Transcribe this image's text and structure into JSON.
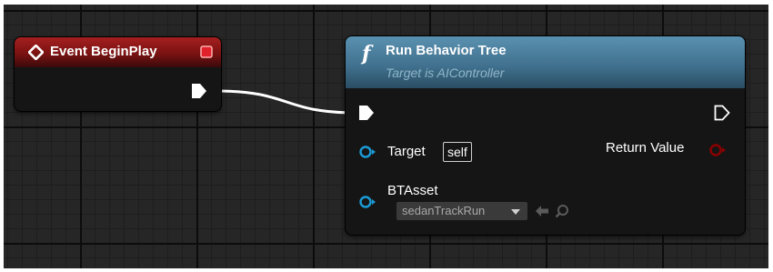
{
  "begin_play_node": {
    "title": "Event BeginPlay",
    "header_color": "#7a1212",
    "icons": {
      "event": "event-diamond-icon",
      "delegate": "delegate-square-icon",
      "exec_out": "exec-out-pin-icon"
    }
  },
  "run_bt_node": {
    "title": "Run Behavior Tree",
    "subtitle": "Target is AIController",
    "header_color": "#4a7a96",
    "icons": {
      "function": "function-f-icon",
      "exec_in": "exec-in-pin-icon",
      "exec_out": "exec-out-pin-icon",
      "target": "object-pin-icon",
      "bt_asset": "object-pin-icon",
      "return_value": "bool-pin-icon",
      "use_asset": "use-selected-asset-arrow-icon",
      "browse": "browse-magnifier-icon",
      "dropdown": "chevron-down-icon"
    },
    "target_label": "Target",
    "target_default": "self",
    "return_label": "Return Value",
    "bt_asset_label": "BTAsset",
    "bt_asset_value": "sedanTrackRun",
    "colors": {
      "object_pin": "#1a9bd7",
      "bool_pin": "#8c0000",
      "exec_wire": "#ffffff"
    }
  }
}
